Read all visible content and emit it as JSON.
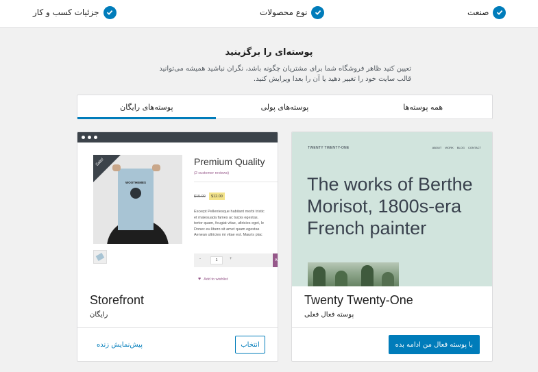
{
  "stepper": {
    "steps": [
      {
        "label": "صنعت"
      },
      {
        "label": "نوع محصولات"
      },
      {
        "label": "جزئیات کسب و کار"
      }
    ]
  },
  "header": {
    "title": "پوسته‌ای را برگزینید",
    "description_line1": "تعیین کنید ظاهر فروشگاه شما برای مشتریان چگونه باشد، نگران نباشید همیشه می‌توانید",
    "description_line2": "قالب سایت خود را تغییر دهید یا آن را بعدا ویرایش کنید."
  },
  "tabs": [
    {
      "label": "همه پوسته‌ها",
      "active": false
    },
    {
      "label": "پوسته‌های پولی",
      "active": false
    },
    {
      "label": "پوسته‌های رایگان",
      "active": true
    }
  ],
  "cards": {
    "twentyone": {
      "name": "Twenty Twenty-One",
      "status": "پوسته فعال فعلی",
      "primary_button": "با پوسته فعال من ادامه بده",
      "preview": {
        "site_title": "TWENTY TWENTY-ONE",
        "nav": [
          "ABOUT",
          "WORK",
          "BLOG",
          "CONTACT"
        ],
        "headline": "The works of Berthe Morisot, 1800s-era French painter"
      }
    },
    "storefront": {
      "name": "Storefront",
      "status": "رایگان",
      "select_button": "انتخاب",
      "preview_link": "پیش‌نمایش زنده",
      "preview": {
        "sale_badge": "Sale!",
        "poster_text": "WOOTHEMES",
        "product_title": "Premium Quality",
        "reviews": "(2 customer reviews)",
        "price_old": "$15.00",
        "price_new": "$12.00",
        "excerpt": "Excerpt Pellentesque habitant morbi tristic\net malesuada fames ac turpis egestas.\ntortor quam, feugiat vitae, ultricies eget, le\nDonec eu libero sit amet quam egestas\nAenean ultricies mi vitae est. Mauris plac",
        "qty": "1",
        "qty_minus": "-",
        "qty_plus": "+",
        "add_button": "Ad",
        "wishlist": "Add to wishlist"
      }
    }
  },
  "colors": {
    "accent": "#007cba",
    "page_bg": "#f1f1f1",
    "tt_bg": "#d1e4dd",
    "woo_purple": "#96588a"
  }
}
